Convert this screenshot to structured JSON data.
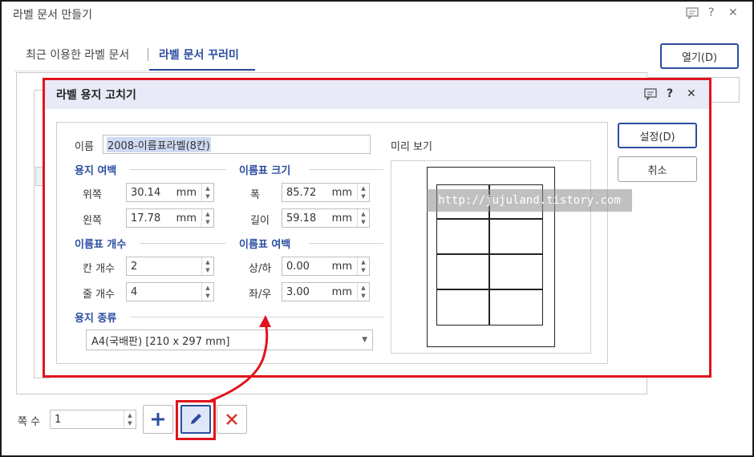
{
  "outer": {
    "title": "라벨 문서 만들기",
    "tabs": [
      "최근 이용한 라벨 문서",
      "라벨 문서 꾸러미"
    ],
    "open_button": "열기(D)"
  },
  "inner": {
    "title": "라벨 용지 고치기",
    "name_label": "이름",
    "name_value": "2008-이름표라벨(8칸)",
    "preview_label": "미리 보기",
    "sections": {
      "margin": "용지 여백",
      "size": "이름표 크기",
      "count": "이름표 개수",
      "spacing": "이름표 여백",
      "paper": "용지 종류"
    },
    "fields": {
      "top": {
        "label": "위쪽",
        "value": "30.14",
        "unit": "mm"
      },
      "left": {
        "label": "왼쪽",
        "value": "17.78",
        "unit": "mm"
      },
      "width": {
        "label": "폭",
        "value": "85.72",
        "unit": "mm"
      },
      "height": {
        "label": "길이",
        "value": "59.18",
        "unit": "mm"
      },
      "cols": {
        "label": "칸 개수",
        "value": "2"
      },
      "rows": {
        "label": "줄 개수",
        "value": "4"
      },
      "vgap": {
        "label": "상/하",
        "value": "0.00",
        "unit": "mm"
      },
      "hgap": {
        "label": "좌/우",
        "value": "3.00",
        "unit": "mm"
      }
    },
    "paper_type": "A4(국배판)  [210 x 297 mm]",
    "confirm_button": "설정(D)",
    "cancel_button": "취소"
  },
  "watermark": "http://jujuland.tistory.com",
  "bottom": {
    "page_count_label": "쪽 수",
    "page_count_value": "1"
  },
  "colors": {
    "accent": "#2b4da0",
    "highlight": "#e0141d",
    "title_bar": "#e8eaf7"
  }
}
